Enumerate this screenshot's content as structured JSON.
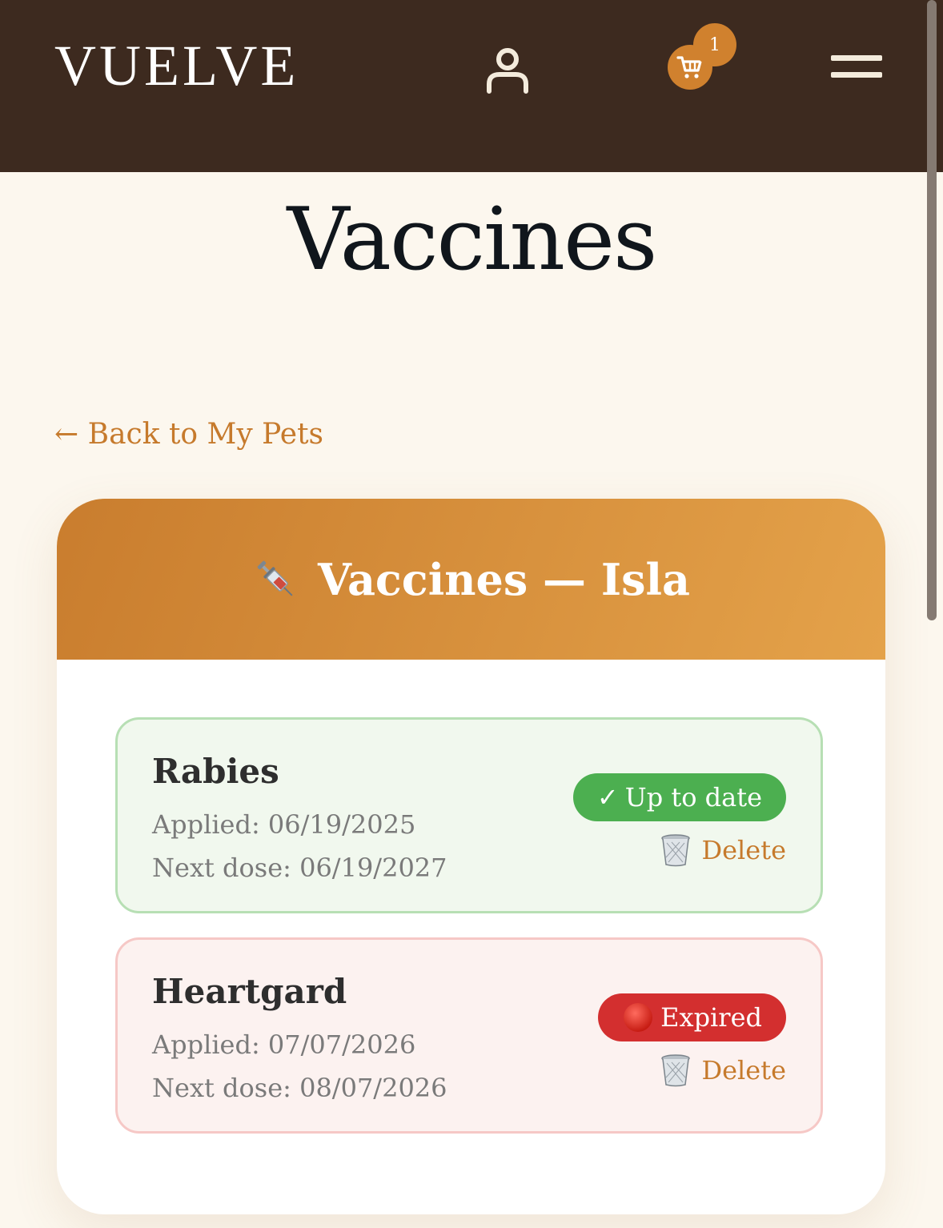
{
  "header": {
    "logo": "VUELVE",
    "cart_count": "1",
    "icons": {
      "user": "user-icon",
      "cart": "cart-icon",
      "menu": "hamburger-menu-icon"
    }
  },
  "page": {
    "title": "Vaccines",
    "back_link": "← Back to My Pets"
  },
  "card": {
    "icon": "syringe-icon",
    "title": "Vaccines — Isla"
  },
  "vaccines": [
    {
      "name": "Rabies",
      "applied": "Applied: 06/19/2025",
      "next_dose": "Next dose: 06/19/2027",
      "status_label": "Up to date",
      "status_icon": "checkmark-icon",
      "status_color": "#4caf50",
      "delete_label": "Delete"
    },
    {
      "name": "Heartgard",
      "applied": "Applied: 07/07/2026",
      "next_dose": "Next dose: 08/07/2026",
      "status_label": "Expired",
      "status_icon": "red-circle-icon",
      "status_color": "#d32f2f",
      "delete_label": "Delete"
    }
  ],
  "colors": {
    "header_bg": "#3d2a1f",
    "accent": "#c67a2c",
    "page_bg": "#fcf7ee"
  }
}
